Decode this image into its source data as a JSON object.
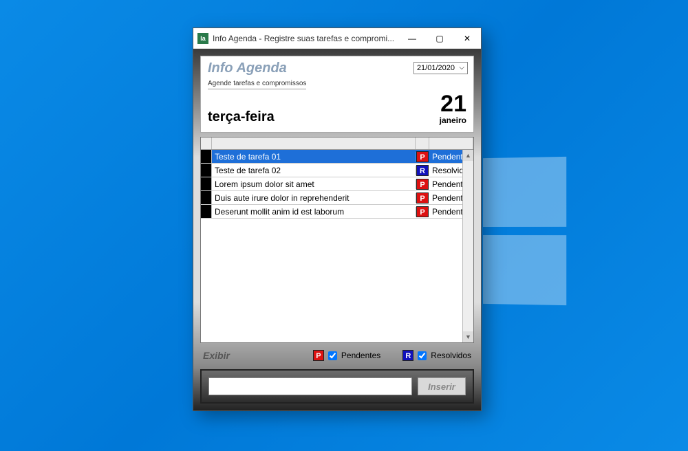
{
  "window": {
    "title": "Info Agenda - Registre suas tarefas e compromi...",
    "icon_text": "Ia"
  },
  "header": {
    "app_title": "Info Agenda",
    "subtitle": "Agende tarefas e compromissos",
    "date_value": "21/01/2020",
    "weekday": "terça-feira",
    "day_number": "21",
    "month": "janeiro"
  },
  "tasks": [
    {
      "text": "Teste de tarefa 01",
      "badge": "P",
      "status": "Pendente",
      "selected": true
    },
    {
      "text": "Teste de tarefa 02",
      "badge": "R",
      "status": "Resolvido",
      "selected": false
    },
    {
      "text": "Lorem ipsum dolor sit amet",
      "badge": "P",
      "status": "Pendente",
      "selected": false
    },
    {
      "text": "Duis aute irure dolor in reprehenderit",
      "badge": "P",
      "status": "Pendente",
      "selected": false
    },
    {
      "text": "Deserunt mollit anim id est laborum",
      "badge": "P",
      "status": "Pendente",
      "selected": false
    }
  ],
  "filters": {
    "label": "Exibir",
    "pending_label": "Pendentes",
    "resolved_label": "Resolvidos",
    "pending_checked": true,
    "resolved_checked": true
  },
  "input": {
    "value": "",
    "button": "Inserir"
  }
}
